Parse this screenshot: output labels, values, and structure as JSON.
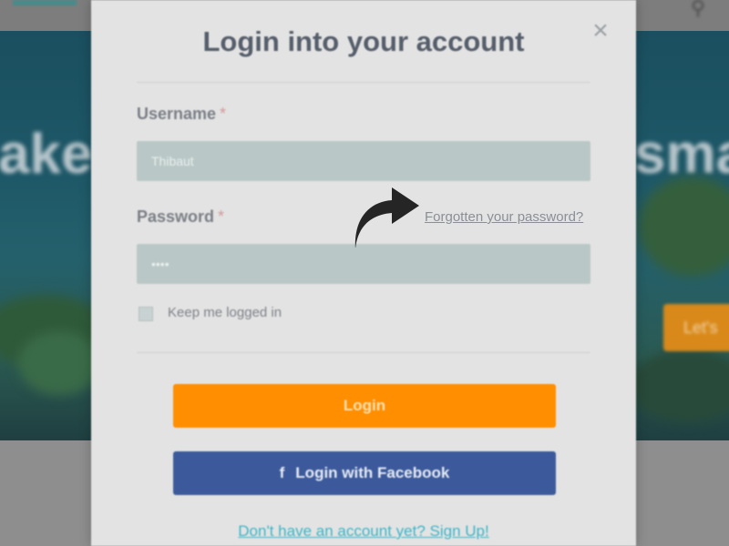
{
  "background": {
    "hero_text_left": "ake",
    "hero_text_right": "sma",
    "hero_button_label": "Let's",
    "search_icon": "search-icon"
  },
  "modal": {
    "title": "Login into your account",
    "close_icon": "close-icon",
    "username": {
      "label": "Username",
      "required_mark": "*",
      "value": "Thibaut"
    },
    "password": {
      "label": "Password",
      "required_mark": "*",
      "value": "••••",
      "forgot_link": "Forgotten your password?"
    },
    "remember": {
      "label": "Keep me logged in",
      "checked": false
    },
    "login_button": "Login",
    "facebook_button": {
      "icon": "f",
      "label": "Login with Facebook"
    },
    "signup_link": "Don't have an account yet? Sign Up!"
  },
  "annotation": {
    "arrow_icon": "curved-arrow-icon"
  },
  "colors": {
    "login_orange": "#ff8e00",
    "facebook_blue": "#3c5a9b",
    "input_bg": "#b9c8c6",
    "link_teal": "#3ab5c7"
  }
}
